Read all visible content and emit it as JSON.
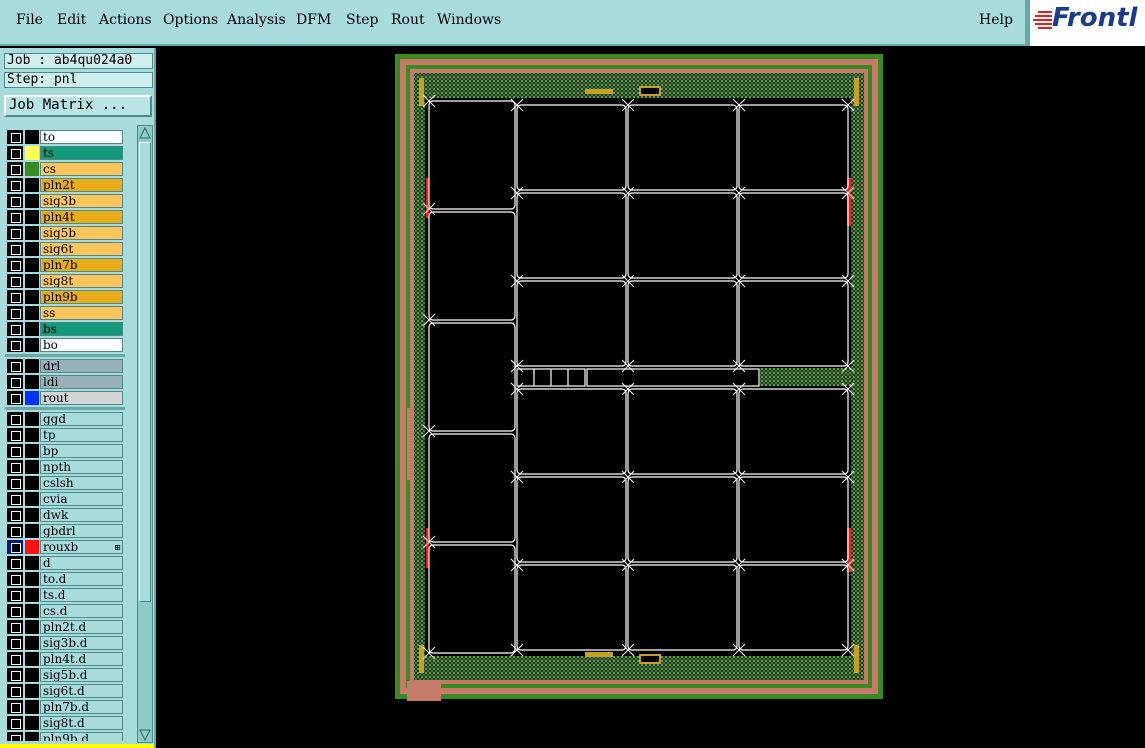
{
  "menubar": {
    "items": [
      "File",
      "Edit",
      "Actions",
      "Options",
      "Analysis",
      "DFM",
      "Step",
      "Rout",
      "Windows"
    ],
    "help": "Help"
  },
  "logo": {
    "text": "Frontl"
  },
  "panel": {
    "job": "Job : ab4qu024a0",
    "step": "Step: pnl",
    "job_matrix": "Job Matrix ..."
  },
  "layers": [
    {
      "name": "to",
      "bg": "#ffffff",
      "color": "#000000"
    },
    {
      "name": "ts",
      "bg": "#129a7a",
      "color": "#ffff55"
    },
    {
      "name": "cs",
      "bg": "#ffc45a",
      "color": "#3a8a22"
    },
    {
      "name": "pln2t",
      "bg": "#e8ac18",
      "color": "#000000"
    },
    {
      "name": "sig3b",
      "bg": "#ffc45a",
      "color": "#000000"
    },
    {
      "name": "pln4t",
      "bg": "#e8ac18",
      "color": "#000000"
    },
    {
      "name": "sig5b",
      "bg": "#ffc45a",
      "color": "#000000"
    },
    {
      "name": "sig6t",
      "bg": "#ffc45a",
      "color": "#000000"
    },
    {
      "name": "pln7b",
      "bg": "#e8ac18",
      "color": "#000000"
    },
    {
      "name": "sig8t",
      "bg": "#ffc45a",
      "color": "#000000"
    },
    {
      "name": "pln9b",
      "bg": "#e8ac18",
      "color": "#000000"
    },
    {
      "name": "ss",
      "bg": "#ffc45a",
      "color": "#000000"
    },
    {
      "name": "bs",
      "bg": "#129a7a",
      "color": "#000000"
    },
    {
      "name": "bo",
      "bg": "#ffffff",
      "color": "#000000",
      "sep_after": true
    },
    {
      "name": "drl",
      "bg": "#98b0b8",
      "color": "#000000"
    },
    {
      "name": "ldi",
      "bg": "#98b0b8",
      "color": "#000000"
    },
    {
      "name": "rout",
      "bg": "#d4d4d4",
      "color": "#0030ff",
      "sep_after": true
    },
    {
      "name": "ggd",
      "bg": "#a8dcdc",
      "color": "#000000"
    },
    {
      "name": "tp",
      "bg": "#a8dcdc",
      "color": "#000000"
    },
    {
      "name": "bp",
      "bg": "#a8dcdc",
      "color": "#000000"
    },
    {
      "name": "npth",
      "bg": "#a8dcdc",
      "color": "#000000"
    },
    {
      "name": "cslsh",
      "bg": "#a8dcdc",
      "color": "#000000"
    },
    {
      "name": "cvia",
      "bg": "#a8dcdc",
      "color": "#000000"
    },
    {
      "name": "dwk",
      "bg": "#a8dcdc",
      "color": "#000000"
    },
    {
      "name": "gbdrl",
      "bg": "#a8dcdc",
      "color": "#000000"
    },
    {
      "name": "rouxb",
      "bg": "#a8dcdc",
      "color": "#ff1010",
      "check": "#001880",
      "marker": "⊞"
    },
    {
      "name": "d",
      "bg": "#a8dcdc",
      "color": "#000000"
    },
    {
      "name": "to.d",
      "bg": "#a8dcdc",
      "color": "#000000"
    },
    {
      "name": "ts.d",
      "bg": "#a8dcdc",
      "color": "#000000"
    },
    {
      "name": "cs.d",
      "bg": "#a8dcdc",
      "color": "#000000"
    },
    {
      "name": "pln2t.d",
      "bg": "#a8dcdc",
      "color": "#000000"
    },
    {
      "name": "sig3b.d",
      "bg": "#a8dcdc",
      "color": "#000000"
    },
    {
      "name": "pln4t.d",
      "bg": "#a8dcdc",
      "color": "#000000"
    },
    {
      "name": "sig5b.d",
      "bg": "#a8dcdc",
      "color": "#000000"
    },
    {
      "name": "sig6t.d",
      "bg": "#a8dcdc",
      "color": "#000000"
    },
    {
      "name": "pln7b.d",
      "bg": "#a8dcdc",
      "color": "#000000"
    },
    {
      "name": "sig8t.d",
      "bg": "#a8dcdc",
      "color": "#000000"
    },
    {
      "name": "pln9b.d",
      "bg": "#a8dcdc",
      "color": "#000000"
    }
  ],
  "colors": {
    "panel_border_green": "#3a8a22",
    "panel_border_pink": "#c87a6a",
    "dotted_fill": "#2e5a2e",
    "board_line": "#ffffff",
    "red_marker": "#ff1a1a"
  }
}
